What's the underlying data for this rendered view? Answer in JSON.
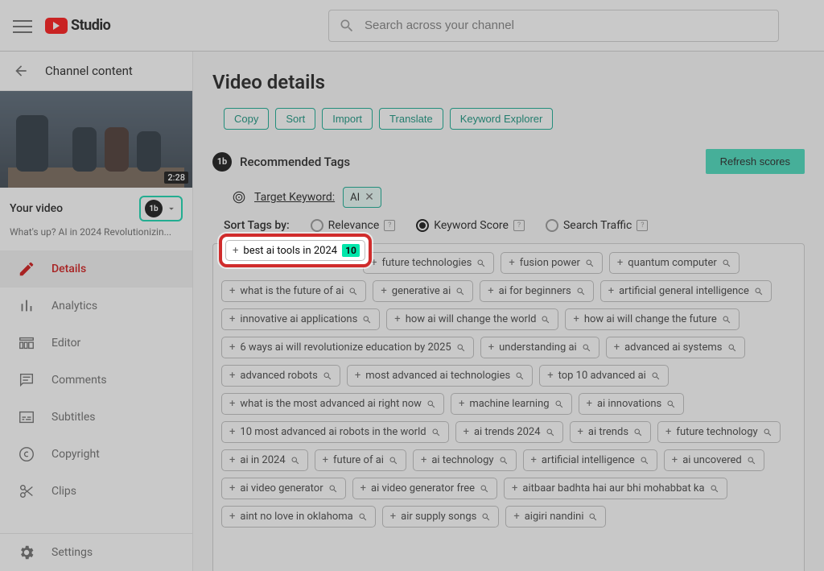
{
  "topbar": {
    "logo_text": "Studio",
    "search_placeholder": "Search across your channel"
  },
  "sidebar": {
    "back_label": "Channel content",
    "video": {
      "duration": "2:28",
      "section_label": "Your video",
      "subtitle": "What's up? AI in 2024 Revolutionizin...",
      "tb_badge": "1b"
    },
    "nav": {
      "details": "Details",
      "analytics": "Analytics",
      "editor": "Editor",
      "comments": "Comments",
      "subtitles": "Subtitles",
      "copyright": "Copyright",
      "clips": "Clips",
      "settings": "Settings"
    }
  },
  "main": {
    "title": "Video details",
    "actions": {
      "copy": "Copy",
      "sort": "Sort",
      "import": "Import",
      "translate": "Translate",
      "explorer": "Keyword Explorer"
    },
    "recommended": {
      "logo": "1b",
      "title": "Recommended Tags",
      "refresh": "Refresh scores",
      "target_label": "Target Keyword:",
      "target_value": "AI"
    },
    "sort": {
      "label": "Sort Tags by:",
      "relevance": "Relevance",
      "keyword_score": "Keyword Score",
      "search_traffic": "Search Traffic"
    },
    "highlight": {
      "text": "best ai tools in 2024",
      "score": "10"
    },
    "tags": [
      "best ai tools in 2024",
      "future technologies",
      "fusion power",
      "quantum computer",
      "what is the future of ai",
      "generative ai",
      "ai for beginners",
      "artificial general intelligence",
      "innovative ai applications",
      "how ai will change the world",
      "how ai will change the future",
      "6 ways ai will revolutionize education by 2025",
      "understanding ai",
      "advanced ai systems",
      "advanced robots",
      "most advanced ai technologies",
      "top 10 advanced ai",
      "what is the most advanced ai right now",
      "machine learning",
      "ai innovations",
      "10 most advanced ai robots in the world",
      "ai trends 2024",
      "ai trends",
      "future technology",
      "ai in 2024",
      "future of ai",
      "ai technology",
      "artificial intelligence",
      "ai uncovered",
      "ai video generator",
      "ai video generator free",
      "aitbaar badhta hai aur bhi mohabbat ka",
      "aint no love in oklahoma",
      "air supply songs",
      "aigiri nandini"
    ]
  }
}
